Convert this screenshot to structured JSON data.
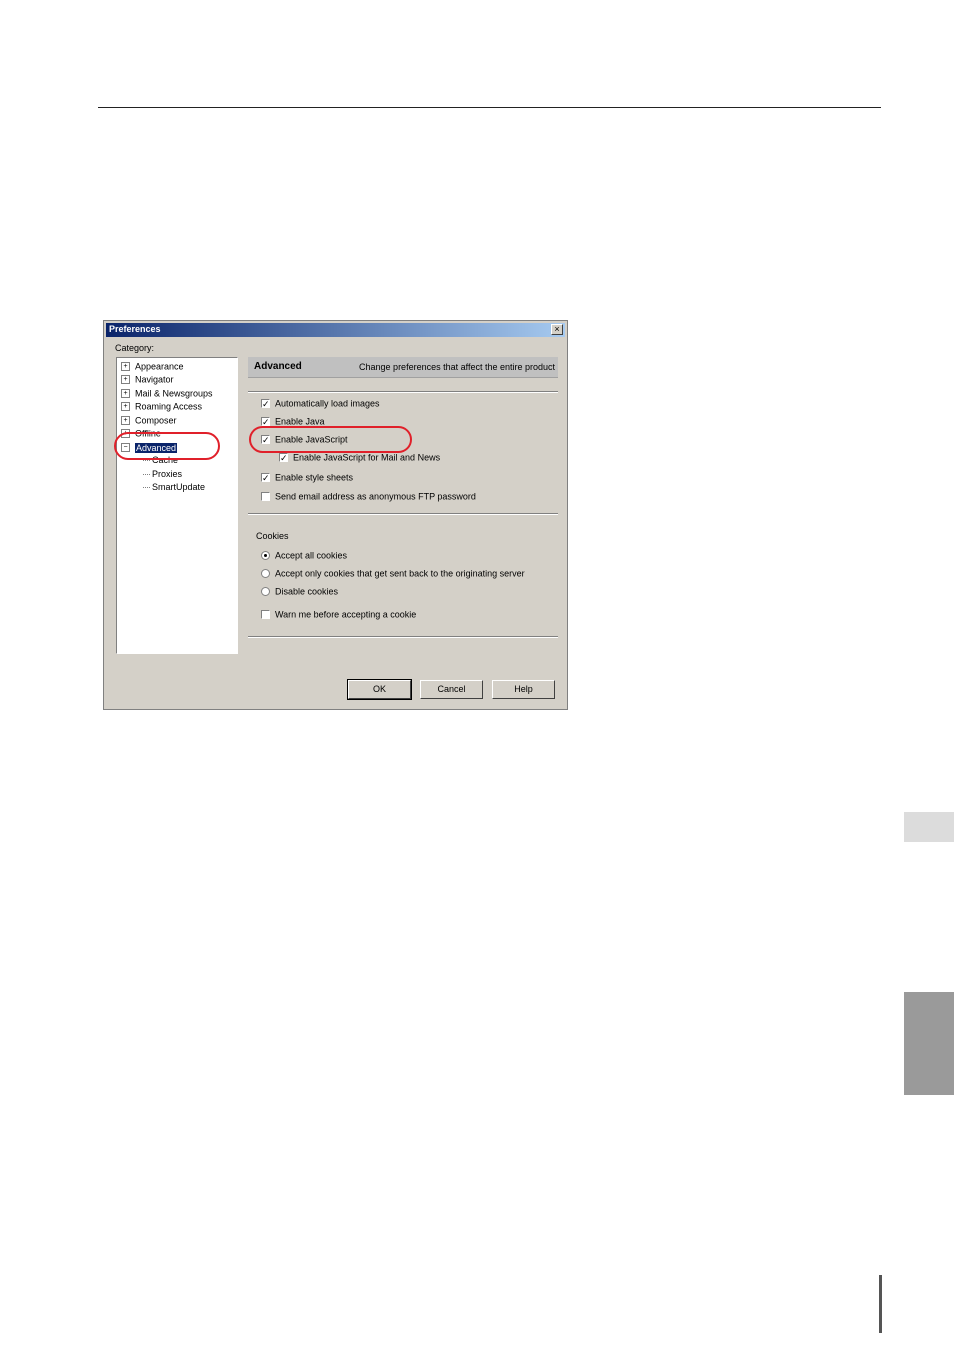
{
  "dialog": {
    "title": "Preferences",
    "close_glyph": "×",
    "category_label": "Category:",
    "tree": [
      {
        "label": "Appearance",
        "state": "+"
      },
      {
        "label": "Navigator",
        "state": "+"
      },
      {
        "label": "Mail & Newsgroups",
        "state": "+"
      },
      {
        "label": "Roaming Access",
        "state": "+"
      },
      {
        "label": "Composer",
        "state": "+"
      },
      {
        "label": "Offline",
        "state": "+"
      },
      {
        "label": "Advanced",
        "state": "−",
        "selected": true
      }
    ],
    "tree_children": [
      "Cache",
      "Proxies",
      "SmartUpdate"
    ],
    "header": {
      "title": "Advanced",
      "description": "Change preferences that affect the entire product"
    },
    "options": [
      {
        "label": "Automatically load images",
        "checked": true
      },
      {
        "label": "Enable Java",
        "checked": true
      },
      {
        "label": "Enable JavaScript",
        "checked": true
      },
      {
        "label": "Enable JavaScript for Mail and News",
        "checked": true
      },
      {
        "label": "Enable style sheets",
        "checked": true
      },
      {
        "label": "Send email address as anonymous FTP password",
        "checked": false
      }
    ],
    "cookies": {
      "group_label": "Cookies",
      "radios": [
        {
          "label": "Accept all cookies",
          "selected": true
        },
        {
          "label": "Accept only cookies that get sent back to the originating server",
          "selected": false
        },
        {
          "label": "Disable cookies",
          "selected": false
        }
      ],
      "warn": {
        "label": "Warn me before accepting a cookie",
        "checked": false
      }
    },
    "buttons": {
      "ok": "OK",
      "cancel": "Cancel",
      "help": "Help"
    },
    "check_glyph": "✓"
  },
  "colors": {
    "highlight_ring": "#e0202a",
    "titlebar": "#0a246a",
    "dialog_face": "#d4d0c8"
  }
}
